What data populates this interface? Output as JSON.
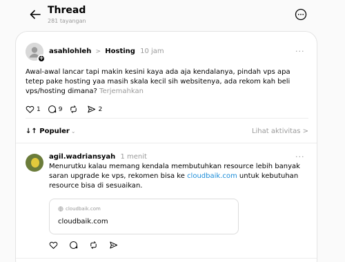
{
  "header": {
    "title": "Thread",
    "subtitle": "281 tayangan",
    "icons": {
      "back": "arrow-left-icon",
      "more": "more-circle-icon"
    }
  },
  "post": {
    "username": "asahlohleh",
    "separator": ">",
    "topic": "Hosting",
    "time": "10 jam",
    "more": "···",
    "text": "Awal-awal lancar tapi makin kesini kaya ada aja kendalanya, pindah vps apa tetep pake hosting yaa masih skala kecil sih websitenya, ada rekom kah beli vps/hosting dimana?",
    "translate": "Terjemahkan",
    "likes": "1",
    "comments": "9",
    "shares": "2"
  },
  "sort": {
    "label": "↓↑ Populer",
    "chevron": "⌄",
    "activity": "Lihat aktivitas >"
  },
  "reply": {
    "username": "agil.wadriansyah",
    "time": "1 menit",
    "more": "···",
    "text_before": "Menurutku kalau memang kendala membutuhkan resource lebih banyak saran upgrade ke vps, rekomen bisa ke ",
    "link": "cloudbaik.com",
    "text_after": " untuk kebutuhan resource bisa di sesuaikan.",
    "link_card": {
      "domain": "cloudbaik.com",
      "title": "cloudbaik.com"
    }
  },
  "colors": {
    "link": "#1a8cd8",
    "muted": "#999999",
    "border": "#e3e3e3"
  }
}
